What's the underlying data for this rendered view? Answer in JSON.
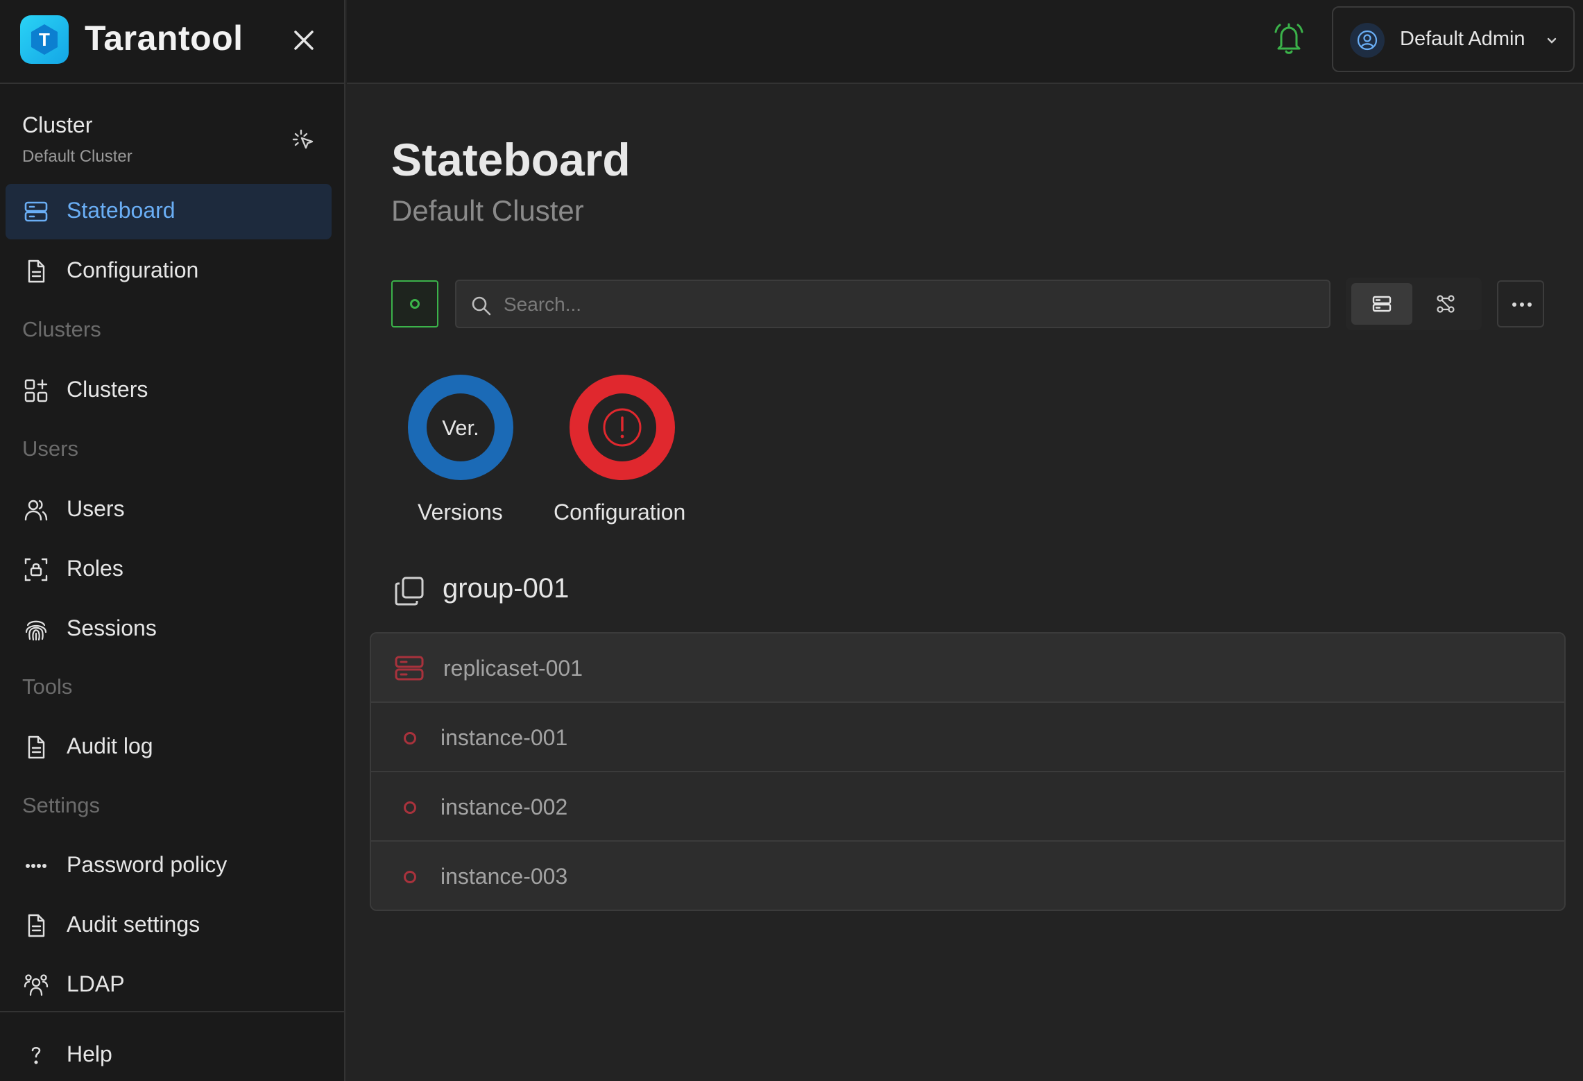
{
  "app": {
    "name": "Tarantool"
  },
  "cluster": {
    "title": "Cluster",
    "name": "Default Cluster"
  },
  "sidebar": {
    "items": [
      {
        "label": "Stateboard",
        "active": true
      },
      {
        "label": "Configuration"
      },
      {
        "section": "Clusters"
      },
      {
        "label": "Clusters"
      },
      {
        "section": "Users"
      },
      {
        "label": "Users"
      },
      {
        "label": "Roles"
      },
      {
        "label": "Sessions"
      },
      {
        "section": "Tools"
      },
      {
        "label": "Audit log"
      },
      {
        "section": "Settings"
      },
      {
        "label": "Password policy"
      },
      {
        "label": "Audit settings"
      },
      {
        "label": "LDAP"
      },
      {
        "label": "Help"
      }
    ]
  },
  "header": {
    "user_name": "Default Admin",
    "bell_color": "#3bb34a"
  },
  "main": {
    "title": "Stateboard",
    "subtitle": "Default Cluster",
    "search_placeholder": "Search...",
    "indicators": [
      {
        "label": "Versions",
        "center_text": "Ver.",
        "color": "#1b6ab6"
      },
      {
        "label": "Configuration",
        "center_text": "!",
        "color": "#e0282e"
      }
    ],
    "group": {
      "name": "group-001",
      "replicaset": "replicaset-001",
      "instances": [
        "instance-001",
        "instance-002",
        "instance-003"
      ]
    }
  },
  "colors": {
    "accent": "#6aaef5",
    "active_bg": "#1d2a3d",
    "error": "#a8323c",
    "ok": "#3bb34a"
  }
}
